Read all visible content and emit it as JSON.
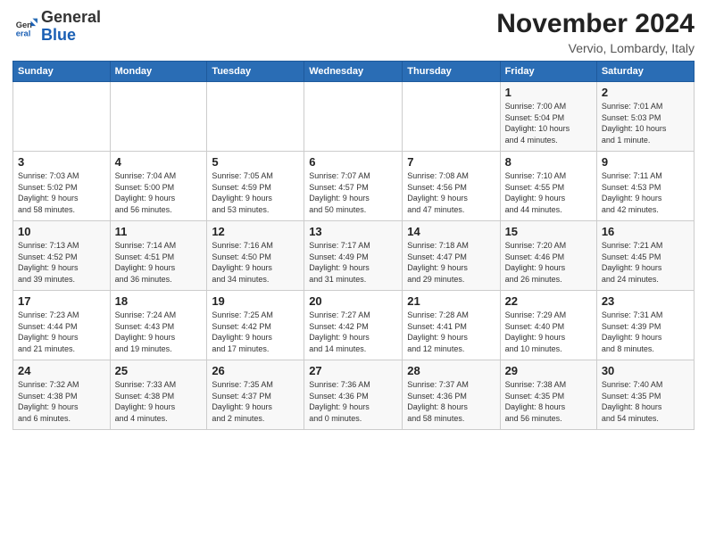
{
  "logo": {
    "general": "General",
    "blue": "Blue"
  },
  "header": {
    "month": "November 2024",
    "location": "Vervio, Lombardy, Italy"
  },
  "weekdays": [
    "Sunday",
    "Monday",
    "Tuesday",
    "Wednesday",
    "Thursday",
    "Friday",
    "Saturday"
  ],
  "weeks": [
    [
      {
        "day": "",
        "info": ""
      },
      {
        "day": "",
        "info": ""
      },
      {
        "day": "",
        "info": ""
      },
      {
        "day": "",
        "info": ""
      },
      {
        "day": "",
        "info": ""
      },
      {
        "day": "1",
        "info": "Sunrise: 7:00 AM\nSunset: 5:04 PM\nDaylight: 10 hours\nand 4 minutes."
      },
      {
        "day": "2",
        "info": "Sunrise: 7:01 AM\nSunset: 5:03 PM\nDaylight: 10 hours\nand 1 minute."
      }
    ],
    [
      {
        "day": "3",
        "info": "Sunrise: 7:03 AM\nSunset: 5:02 PM\nDaylight: 9 hours\nand 58 minutes."
      },
      {
        "day": "4",
        "info": "Sunrise: 7:04 AM\nSunset: 5:00 PM\nDaylight: 9 hours\nand 56 minutes."
      },
      {
        "day": "5",
        "info": "Sunrise: 7:05 AM\nSunset: 4:59 PM\nDaylight: 9 hours\nand 53 minutes."
      },
      {
        "day": "6",
        "info": "Sunrise: 7:07 AM\nSunset: 4:57 PM\nDaylight: 9 hours\nand 50 minutes."
      },
      {
        "day": "7",
        "info": "Sunrise: 7:08 AM\nSunset: 4:56 PM\nDaylight: 9 hours\nand 47 minutes."
      },
      {
        "day": "8",
        "info": "Sunrise: 7:10 AM\nSunset: 4:55 PM\nDaylight: 9 hours\nand 44 minutes."
      },
      {
        "day": "9",
        "info": "Sunrise: 7:11 AM\nSunset: 4:53 PM\nDaylight: 9 hours\nand 42 minutes."
      }
    ],
    [
      {
        "day": "10",
        "info": "Sunrise: 7:13 AM\nSunset: 4:52 PM\nDaylight: 9 hours\nand 39 minutes."
      },
      {
        "day": "11",
        "info": "Sunrise: 7:14 AM\nSunset: 4:51 PM\nDaylight: 9 hours\nand 36 minutes."
      },
      {
        "day": "12",
        "info": "Sunrise: 7:16 AM\nSunset: 4:50 PM\nDaylight: 9 hours\nand 34 minutes."
      },
      {
        "day": "13",
        "info": "Sunrise: 7:17 AM\nSunset: 4:49 PM\nDaylight: 9 hours\nand 31 minutes."
      },
      {
        "day": "14",
        "info": "Sunrise: 7:18 AM\nSunset: 4:47 PM\nDaylight: 9 hours\nand 29 minutes."
      },
      {
        "day": "15",
        "info": "Sunrise: 7:20 AM\nSunset: 4:46 PM\nDaylight: 9 hours\nand 26 minutes."
      },
      {
        "day": "16",
        "info": "Sunrise: 7:21 AM\nSunset: 4:45 PM\nDaylight: 9 hours\nand 24 minutes."
      }
    ],
    [
      {
        "day": "17",
        "info": "Sunrise: 7:23 AM\nSunset: 4:44 PM\nDaylight: 9 hours\nand 21 minutes."
      },
      {
        "day": "18",
        "info": "Sunrise: 7:24 AM\nSunset: 4:43 PM\nDaylight: 9 hours\nand 19 minutes."
      },
      {
        "day": "19",
        "info": "Sunrise: 7:25 AM\nSunset: 4:42 PM\nDaylight: 9 hours\nand 17 minutes."
      },
      {
        "day": "20",
        "info": "Sunrise: 7:27 AM\nSunset: 4:42 PM\nDaylight: 9 hours\nand 14 minutes."
      },
      {
        "day": "21",
        "info": "Sunrise: 7:28 AM\nSunset: 4:41 PM\nDaylight: 9 hours\nand 12 minutes."
      },
      {
        "day": "22",
        "info": "Sunrise: 7:29 AM\nSunset: 4:40 PM\nDaylight: 9 hours\nand 10 minutes."
      },
      {
        "day": "23",
        "info": "Sunrise: 7:31 AM\nSunset: 4:39 PM\nDaylight: 9 hours\nand 8 minutes."
      }
    ],
    [
      {
        "day": "24",
        "info": "Sunrise: 7:32 AM\nSunset: 4:38 PM\nDaylight: 9 hours\nand 6 minutes."
      },
      {
        "day": "25",
        "info": "Sunrise: 7:33 AM\nSunset: 4:38 PM\nDaylight: 9 hours\nand 4 minutes."
      },
      {
        "day": "26",
        "info": "Sunrise: 7:35 AM\nSunset: 4:37 PM\nDaylight: 9 hours\nand 2 minutes."
      },
      {
        "day": "27",
        "info": "Sunrise: 7:36 AM\nSunset: 4:36 PM\nDaylight: 9 hours\nand 0 minutes."
      },
      {
        "day": "28",
        "info": "Sunrise: 7:37 AM\nSunset: 4:36 PM\nDaylight: 8 hours\nand 58 minutes."
      },
      {
        "day": "29",
        "info": "Sunrise: 7:38 AM\nSunset: 4:35 PM\nDaylight: 8 hours\nand 56 minutes."
      },
      {
        "day": "30",
        "info": "Sunrise: 7:40 AM\nSunset: 4:35 PM\nDaylight: 8 hours\nand 54 minutes."
      }
    ]
  ]
}
